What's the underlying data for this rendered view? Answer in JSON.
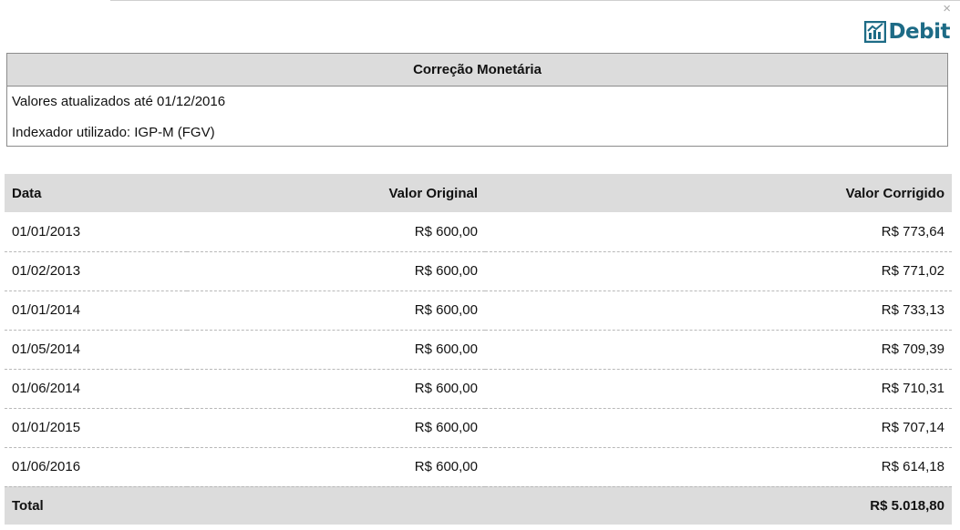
{
  "window": {
    "close_glyph": "×"
  },
  "brand": {
    "logo_text": "Debit",
    "logo_color": "#1d6b86"
  },
  "info": {
    "title": "Correção Monetária",
    "updated_line": "Valores atualizados até 01/12/2016",
    "index_line": "Indexador utilizado: IGP-M (FGV)"
  },
  "table": {
    "headers": {
      "date": "Data",
      "original": "Valor Original",
      "corrected": "Valor Corrigido"
    },
    "rows": [
      {
        "date": "01/01/2013",
        "original": "R$ 600,00",
        "corrected": "R$ 773,64"
      },
      {
        "date": "01/02/2013",
        "original": "R$ 600,00",
        "corrected": "R$ 771,02"
      },
      {
        "date": "01/01/2014",
        "original": "R$ 600,00",
        "corrected": "R$ 733,13"
      },
      {
        "date": "01/05/2014",
        "original": "R$ 600,00",
        "corrected": "R$ 709,39"
      },
      {
        "date": "01/06/2014",
        "original": "R$ 600,00",
        "corrected": "R$ 710,31"
      },
      {
        "date": "01/01/2015",
        "original": "R$ 600,00",
        "corrected": "R$ 707,14"
      },
      {
        "date": "01/06/2016",
        "original": "R$ 600,00",
        "corrected": "R$ 614,18"
      }
    ],
    "total": {
      "label": "Total",
      "value": "R$ 5.018,80"
    }
  }
}
